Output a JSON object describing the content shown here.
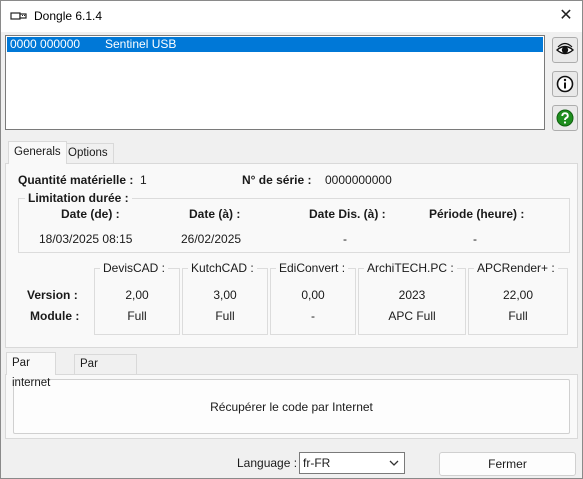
{
  "window": {
    "title": "Dongle 6.1.4",
    "close_symbol": "✕"
  },
  "device_list": {
    "rows": [
      {
        "id": "0000 000000",
        "type": "Sentinel USB"
      }
    ]
  },
  "side_buttons": [
    "eye-icon",
    "info-icon",
    "help-icon"
  ],
  "main_tabs": [
    {
      "label": "Generals"
    },
    {
      "label": "Options"
    }
  ],
  "generals": {
    "quantity_label": "Quantité matérielle :",
    "quantity_value": "1",
    "serial_label": "N° de série :",
    "serial_value": "0000000000",
    "limitation": {
      "title": "Limitation durée :",
      "headers": [
        "Date (de) :",
        "Date (à) :",
        "Date Dis. (à) :",
        "Période (heure) :"
      ],
      "values": [
        "18/03/2025 08:15",
        "26/02/2025",
        "-",
        "-"
      ]
    },
    "row_labels": {
      "version": "Version :",
      "module": "Module :"
    },
    "software": [
      {
        "name": "DevisCAD :",
        "version": "2,00",
        "module": "Full"
      },
      {
        "name": "KutchCAD :",
        "version": "3,00",
        "module": "Full"
      },
      {
        "name": "EdiConvert :",
        "version": "0,00",
        "module": "-"
      },
      {
        "name": "ArchiTECH.PC :",
        "version": "2023",
        "module": "APC Full"
      },
      {
        "name": "APCRender+ :",
        "version": "22,00",
        "module": "Full"
      }
    ]
  },
  "retrieve_tabs": [
    {
      "label": "Par internet"
    },
    {
      "label": "Par téléphone"
    }
  ],
  "retrieve_button": "Récupérer le code par Internet",
  "footer": {
    "language_label": "Language :",
    "language_value": "fr-FR",
    "close_button": "Fermer"
  },
  "colors": {
    "selection": "#0078d7",
    "help_green": "#1e8e1e"
  }
}
